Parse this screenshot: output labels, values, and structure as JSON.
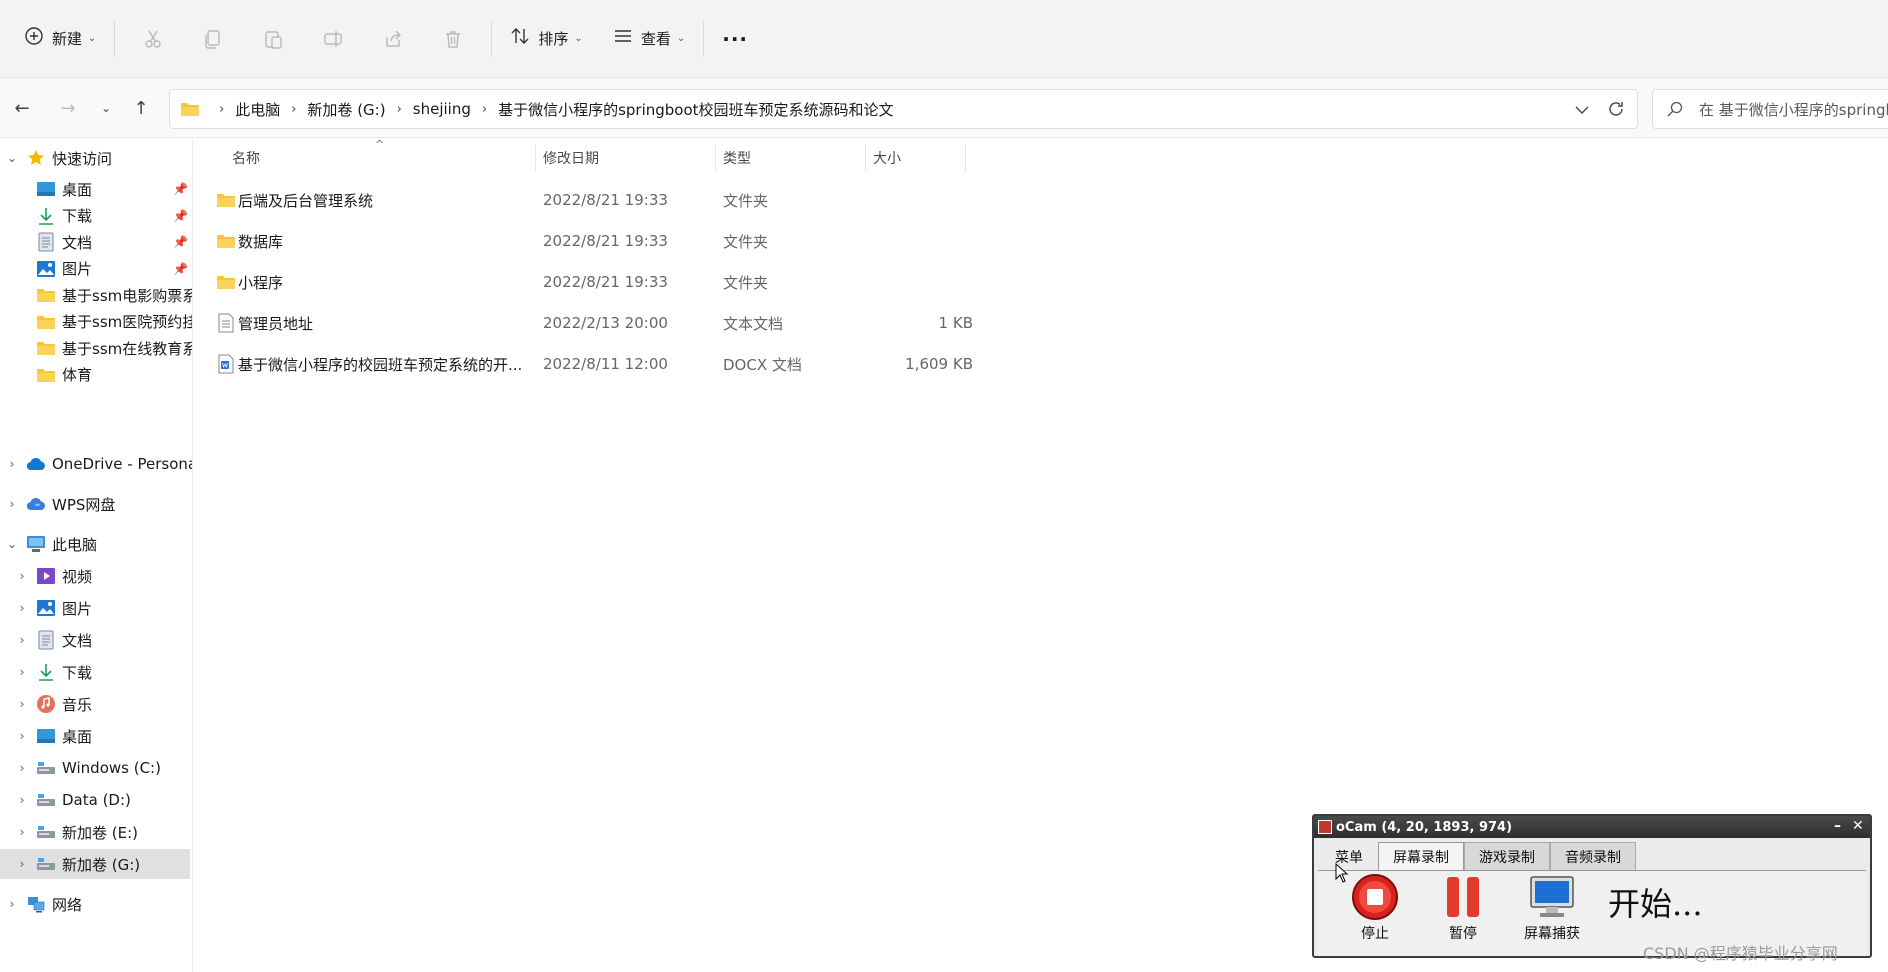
{
  "toolbar": {
    "new_label": "新建",
    "sort_label": "排序",
    "view_label": "查看",
    "more_label": "···"
  },
  "address": {
    "crumbs": [
      "此电脑",
      "新加卷 (G:)",
      "shejiing",
      "基于微信小程序的springboot校园班车预定系统源码和论文"
    ],
    "search_placeholder": "在 基于微信小程序的springboot校园班车预定系统源码和论文 中搜索"
  },
  "sidebar": {
    "quick_access": "快速访问",
    "quick_items": [
      {
        "label": "桌面",
        "icon": "desktop-icon"
      },
      {
        "label": "下载",
        "icon": "download-icon"
      },
      {
        "label": "文档",
        "icon": "document-icon"
      },
      {
        "label": "图片",
        "icon": "pictures-icon"
      },
      {
        "label": "基于ssm电影购票系",
        "icon": "folder-icon"
      },
      {
        "label": "基于ssm医院预约挂",
        "icon": "folder-icon"
      },
      {
        "label": "基于ssm在线教育系",
        "icon": "folder-icon"
      },
      {
        "label": "体育",
        "icon": "folder-icon"
      }
    ],
    "onedrive": "OneDrive - Persona",
    "wps": "WPS网盘",
    "this_pc": "此电脑",
    "pc_items": [
      {
        "label": "视频",
        "icon": "video-icon"
      },
      {
        "label": "图片",
        "icon": "pictures-icon"
      },
      {
        "label": "文档",
        "icon": "document-icon"
      },
      {
        "label": "下载",
        "icon": "download-icon"
      },
      {
        "label": "音乐",
        "icon": "music-icon"
      },
      {
        "label": "桌面",
        "icon": "desktop-icon"
      },
      {
        "label": "Windows (C:)",
        "icon": "drive-icon"
      },
      {
        "label": "Data (D:)",
        "icon": "drive-icon"
      },
      {
        "label": "新加卷 (E:)",
        "icon": "drive-icon"
      },
      {
        "label": "新加卷 (G:)",
        "icon": "drive-icon"
      }
    ],
    "network": "网络"
  },
  "columns": {
    "name": "名称",
    "modified": "修改日期",
    "type": "类型",
    "size": "大小"
  },
  "files": [
    {
      "name": "后端及后台管理系统",
      "modified": "2022/8/21 19:33",
      "type": "文件夹",
      "size": "",
      "icon": "folder-icon"
    },
    {
      "name": "数据库",
      "modified": "2022/8/21 19:33",
      "type": "文件夹",
      "size": "",
      "icon": "folder-icon"
    },
    {
      "name": "小程序",
      "modified": "2022/8/21 19:33",
      "type": "文件夹",
      "size": "",
      "icon": "folder-icon"
    },
    {
      "name": "管理员地址",
      "modified": "2022/2/13 20:00",
      "type": "文本文档",
      "size": "1 KB",
      "icon": "text-file-icon"
    },
    {
      "name": "基于微信小程序的校园班车预定系统的开...",
      "modified": "2022/8/11 12:00",
      "type": "DOCX 文档",
      "size": "1,609 KB",
      "icon": "docx-file-icon"
    }
  ],
  "ocam": {
    "title": "oCam (4, 20, 1893, 974)",
    "tabs": [
      "菜单",
      "屏幕录制",
      "游戏录制",
      "音频录制"
    ],
    "buttons": [
      "停止",
      "暂停",
      "屏幕捕获"
    ],
    "status": "开始..."
  },
  "watermark": "CSDN @程序猿毕业分享网",
  "colors": {
    "folder": "#f8c53a",
    "selected": "#e0e0e0",
    "ocam_stop": "#d9221c",
    "ocam_pause": "#e23a2c",
    "accent": "#0067c0"
  }
}
